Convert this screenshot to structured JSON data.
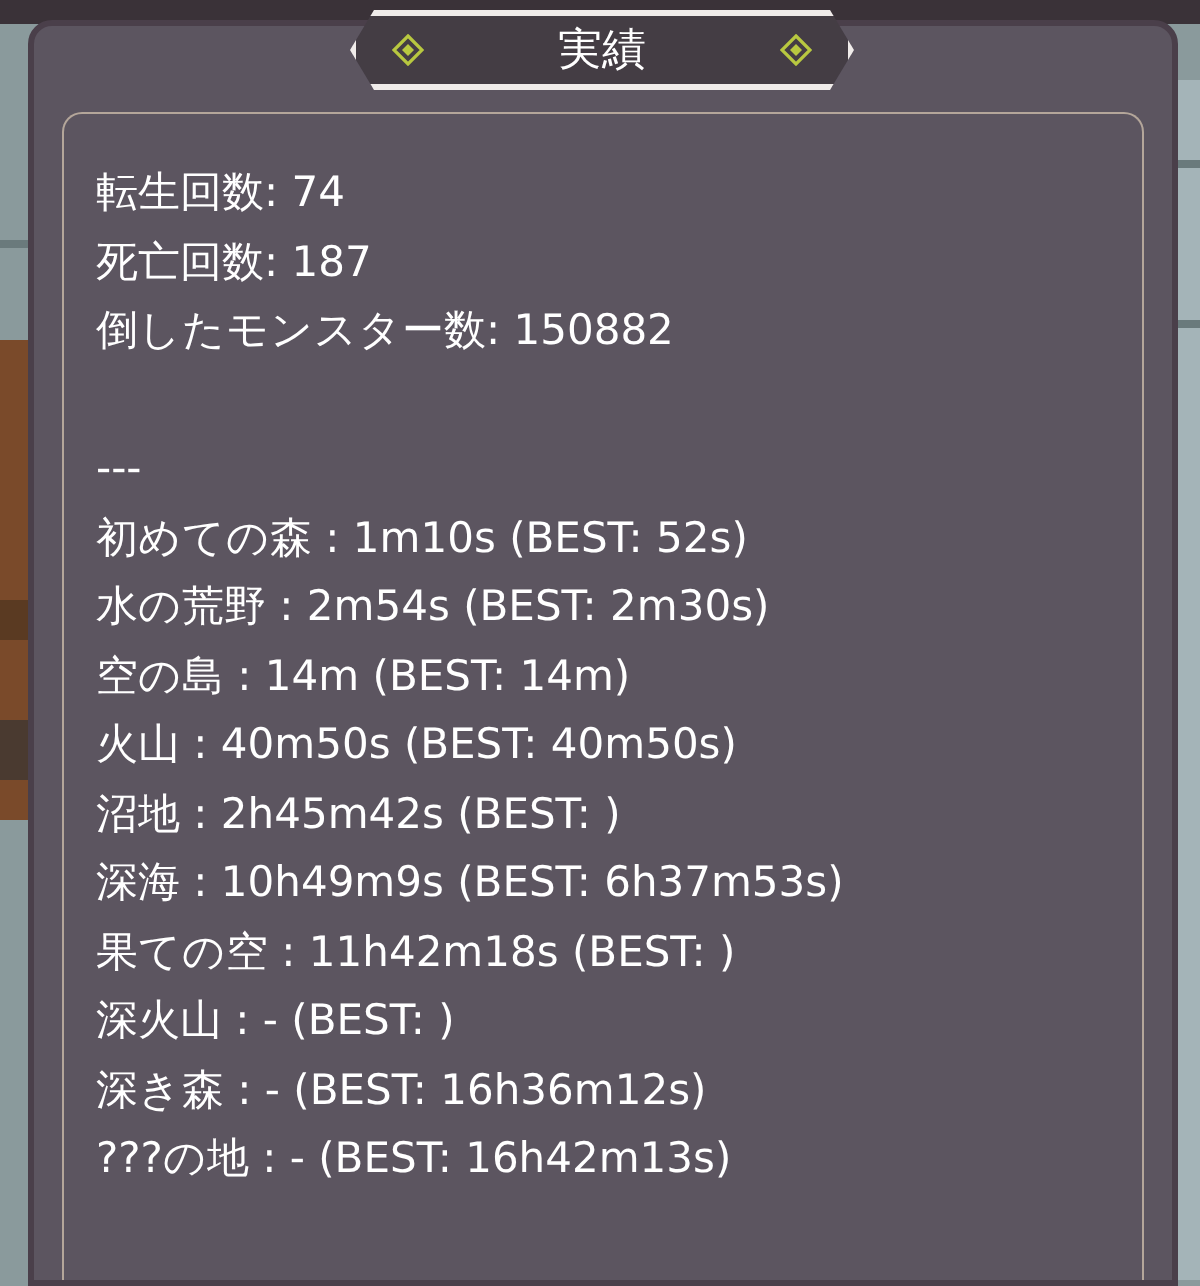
{
  "window": {
    "title": "実績"
  },
  "stats": [
    "転生回数: 74",
    "死亡回数: 187",
    "倒したモンスター数: 150882"
  ],
  "separator": "---",
  "records": [
    "初めての森 : 1m10s (BEST: 52s)",
    "水の荒野 : 2m54s (BEST: 2m30s)",
    "空の島 : 14m (BEST: 14m)",
    "火山 : 40m50s (BEST: 40m50s)",
    "沼地 : 2h45m42s (BEST: )",
    "深海 : 10h49m9s (BEST: 6h37m53s)",
    "果ての空 : 11h42m18s (BEST: )",
    "深火山 : - (BEST: )",
    "深き森 : - (BEST: 16h36m12s)",
    "???の地 : - (BEST: 16h42m13s)"
  ]
}
